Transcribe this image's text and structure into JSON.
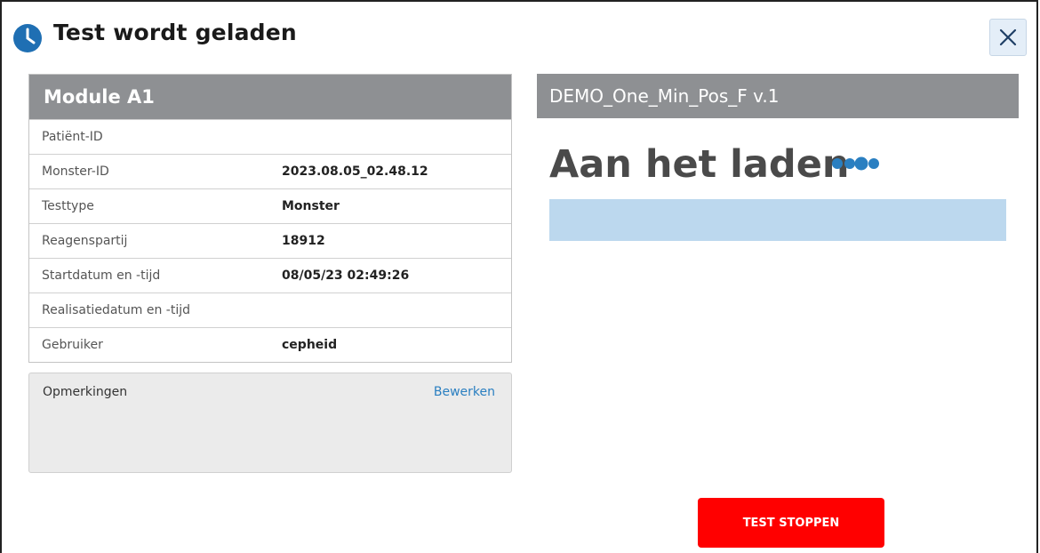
{
  "dialog": {
    "title": "Test wordt geladen",
    "icon": "clock-icon",
    "close_icon": "close-icon"
  },
  "module": {
    "title": "Module A1",
    "rows": [
      {
        "label": "Patiënt-ID",
        "value": ""
      },
      {
        "label": "Monster-ID",
        "value": "2023.08.05_02.48.12"
      },
      {
        "label": "Testtype",
        "value": "Monster"
      },
      {
        "label": "Reagenspartij",
        "value": "18912"
      },
      {
        "label": "Startdatum en -tijd",
        "value": "08/05/23 02:49:26"
      },
      {
        "label": "Realisatiedatum en -tijd",
        "value": ""
      },
      {
        "label": "Gebruiker",
        "value": "cepheid"
      }
    ]
  },
  "notes": {
    "label": "Opmerkingen",
    "edit_label": "Bewerken"
  },
  "assay": {
    "name": "DEMO_One_Min_Pos_F v.1",
    "status": "Aan het laden",
    "progress": 1.0
  },
  "actions": {
    "stop_label": "TEST STOPPEN"
  },
  "colors": {
    "header_gray": "#8e9093",
    "accent_blue": "#2a7fc1",
    "progress_blue": "#bcd8ee",
    "stop_red": "#ff0000"
  }
}
